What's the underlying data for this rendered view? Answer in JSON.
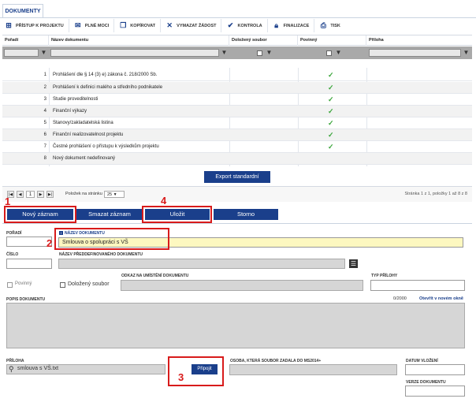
{
  "tab": {
    "label": "DOKUMENTY"
  },
  "toolbar": [
    {
      "label": "PŘÍSTUP K PROJEKTU",
      "icon": "sitemap-icon"
    },
    {
      "label": "PLNÉ MOCI",
      "icon": "envelope-icon"
    },
    {
      "label": "KOPÍROVAT",
      "icon": "copy-icon"
    },
    {
      "label": "VYMAZAT ŽÁDOST",
      "icon": "x-icon"
    },
    {
      "label": "KONTROLA",
      "icon": "check-icon"
    },
    {
      "label": "FINALIZACE",
      "icon": "lock-icon"
    },
    {
      "label": "TISK",
      "icon": "printer-icon"
    }
  ],
  "grid": {
    "columns": [
      "Pořadí",
      "Název dokumentu",
      "Doložený soubor",
      "Povinný",
      "Příloha"
    ],
    "rows": [
      {
        "order": "1",
        "name": "Prohlášení dle § 14 (3) e) zákona č. 218/2000 Sb.",
        "required": "✓"
      },
      {
        "order": "2",
        "name": "Prohlášení k definici malého a středního podnikatele",
        "required": "✓"
      },
      {
        "order": "3",
        "name": "Studie proveditelnosti",
        "required": "✓"
      },
      {
        "order": "4",
        "name": "Finanční výkazy",
        "required": "✓"
      },
      {
        "order": "5",
        "name": "Stanovy/zakladatelská listina",
        "required": "✓"
      },
      {
        "order": "6",
        "name": "Finanční realizovatelnost projektu",
        "required": "✓"
      },
      {
        "order": "7",
        "name": "Čestné prohlášení o přístupu k výsledkům projektu",
        "required": "✓"
      },
      {
        "order": "8",
        "name": "Nový dokument nedefinovaný",
        "required": ""
      }
    ],
    "export_label": "Export standardní"
  },
  "pager": {
    "current_page": "1",
    "per_page_label": "Položek na stránku",
    "per_page_value": "25",
    "summary": "Stránka 1 z 1, položky 1 až 8 z 8"
  },
  "actions": {
    "new": "Nový záznam",
    "delete": "Smazat záznam",
    "save": "Uložit",
    "cancel": "Storno"
  },
  "form": {
    "order_label": "POŘADÍ",
    "name_label": "NÁZEV DOKUMENTU",
    "name_value": "Smlouva o spolupráci s VŠ",
    "number_label": "ČÍSLO",
    "predefined_label": "NÁZEV PŘEDDEFINOVANÉHO DOKUMENTU",
    "required_label": "Povinný",
    "attached_label": "Doložený soubor",
    "location_label": "ODKAZ NA UMÍSTĚNÍ DOKUMENTU",
    "attachment_type_label": "TYP PŘÍLOHY",
    "description_label": "POPIS DOKUMENTU",
    "char_count": "0/2000",
    "open_new_window": "Otevřít v novém okně",
    "attachment_label": "PŘÍLOHA",
    "attachment_value": "smlouva s VŠ.txt",
    "attach_button": "Připojit",
    "person_label": "OSOBA, KTERÁ SOUBOR ZADALA DO MS2014+",
    "date_label": "DATUM VLOŽENÍ",
    "version_label": "VERZE DOKUMENTU"
  },
  "annotations": [
    "1",
    "2",
    "3",
    "4"
  ],
  "colors": {
    "primary": "#1a3f8b",
    "highlight": "#d81b1b",
    "check": "#3aa53a",
    "name_field": "#fdf8c0"
  }
}
